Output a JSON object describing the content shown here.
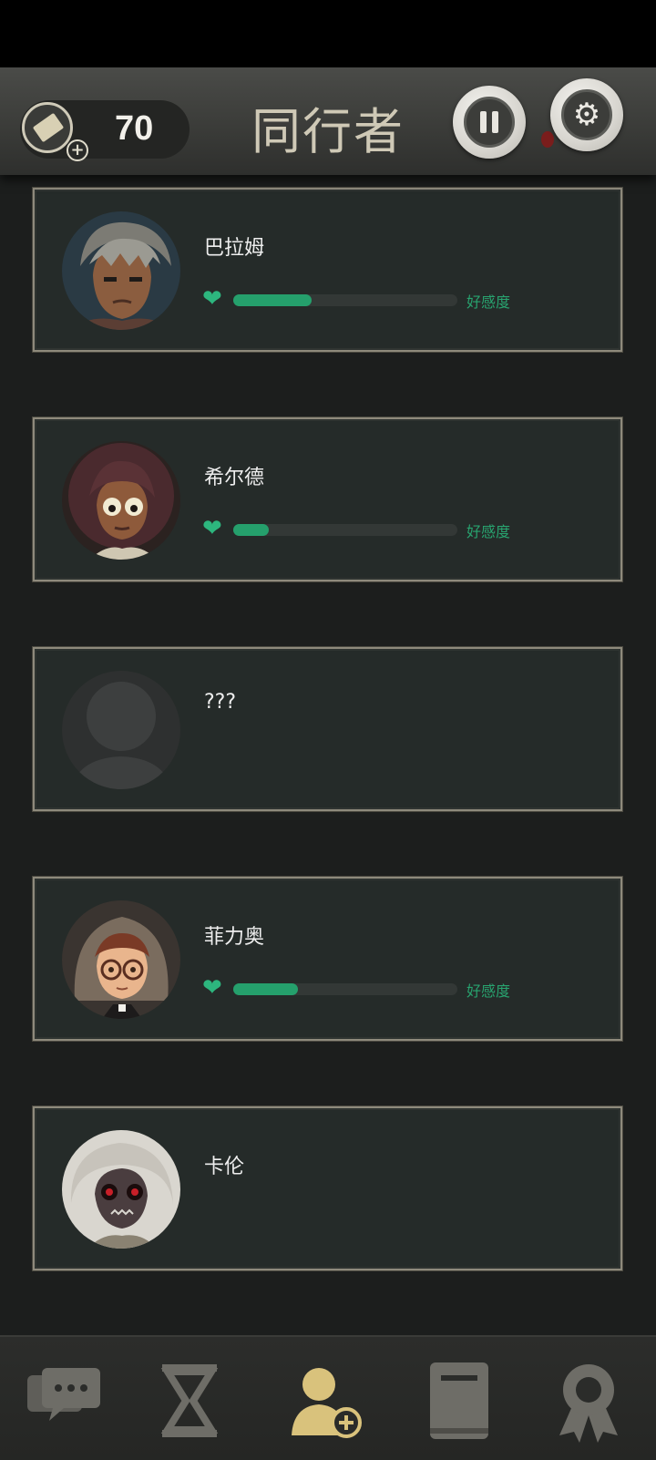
{
  "header": {
    "title": "同行者",
    "ticket_count": "70",
    "icons": {
      "ticket": "ticket-icon",
      "pause": "pause-icon",
      "settings": "gear-icon"
    }
  },
  "companions": [
    {
      "name": "巴拉姆",
      "affinity_label": "好感度",
      "affinity_fraction": 0.35,
      "avatar": "barram-portrait"
    },
    {
      "name": "希尔德",
      "affinity_label": "好感度",
      "affinity_fraction": 0.16,
      "avatar": "hilde-portrait"
    },
    {
      "name": "???",
      "avatar": "unknown-silhouette"
    },
    {
      "name": "菲力奥",
      "affinity_label": "好感度",
      "affinity_fraction": 0.29,
      "avatar": "filio-portrait"
    },
    {
      "name": "卡伦",
      "avatar": "karen-portrait"
    }
  ],
  "bottom_nav": {
    "items": [
      {
        "icon": "chat-icon",
        "active": false
      },
      {
        "icon": "hourglass-icon",
        "active": false
      },
      {
        "icon": "add-companion-icon",
        "active": true
      },
      {
        "icon": "book-icon",
        "active": false
      },
      {
        "icon": "award-icon",
        "active": false
      }
    ]
  },
  "colors": {
    "affinity_green": "#25a06c",
    "nav_active": "#d9c27c",
    "nav_inactive": "#6e6d67"
  }
}
